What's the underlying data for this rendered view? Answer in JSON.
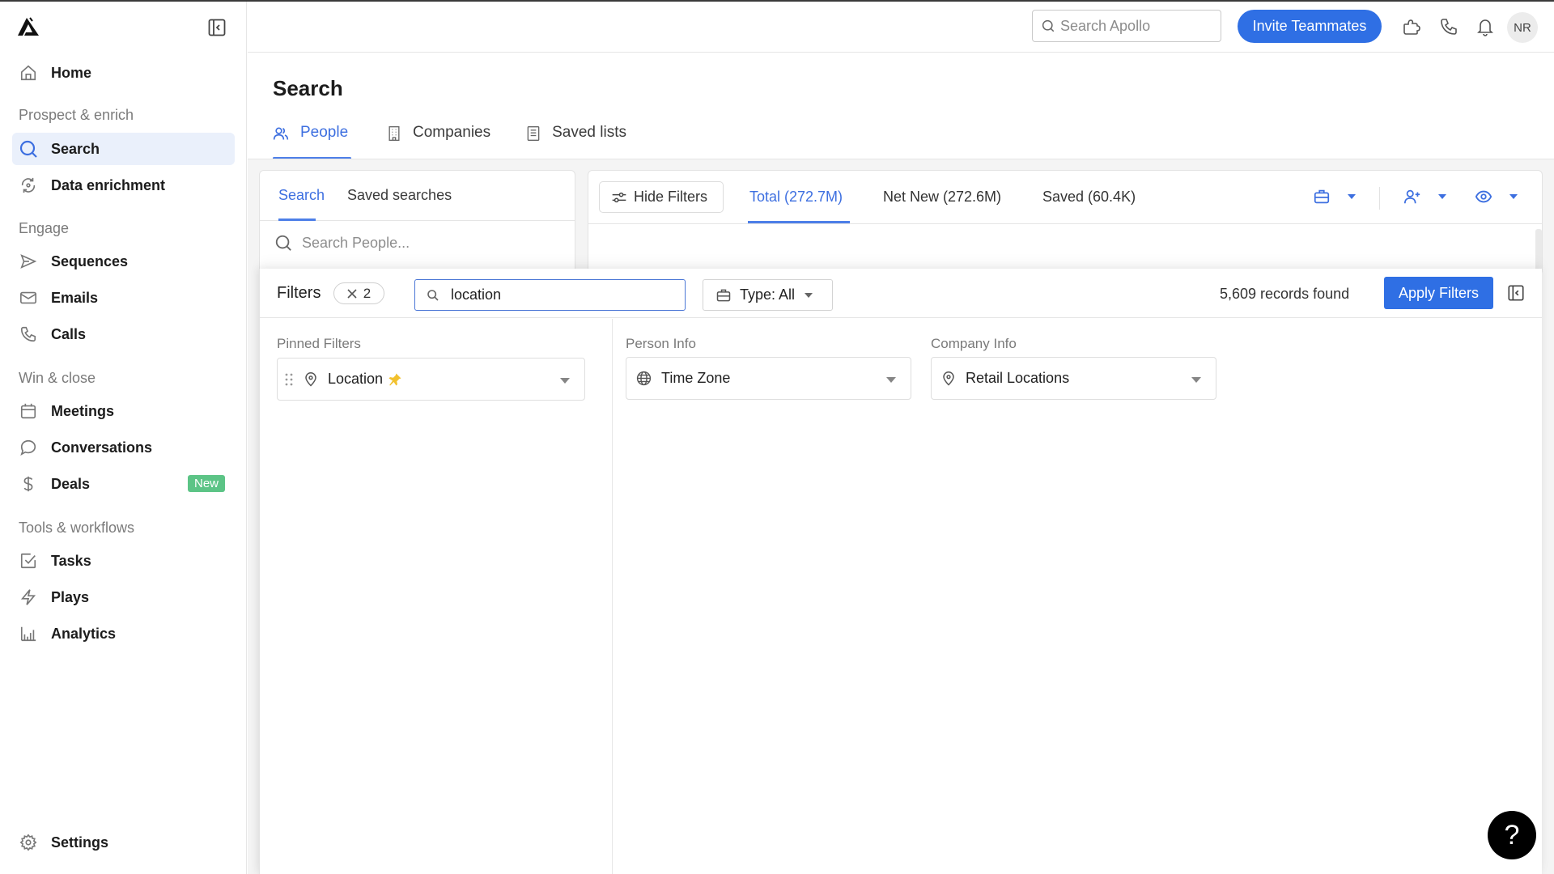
{
  "sidebar": {
    "items": [
      {
        "label": "Home"
      },
      {
        "label": "Search"
      },
      {
        "label": "Data enrichment"
      },
      {
        "label": "Sequences"
      },
      {
        "label": "Emails"
      },
      {
        "label": "Calls"
      },
      {
        "label": "Meetings"
      },
      {
        "label": "Conversations"
      },
      {
        "label": "Deals",
        "badge": "New"
      },
      {
        "label": "Tasks"
      },
      {
        "label": "Plays"
      },
      {
        "label": "Analytics"
      },
      {
        "label": "Settings"
      }
    ],
    "sections": [
      "Prospect & enrich",
      "Engage",
      "Win & close",
      "Tools & workflows"
    ],
    "active_item": "Search"
  },
  "topbar": {
    "search_placeholder": "Search Apollo",
    "invite_label": "Invite Teammates",
    "avatar_initials": "NR"
  },
  "page": {
    "title": "Search",
    "tabs": [
      {
        "label": "People",
        "active": true
      },
      {
        "label": "Companies",
        "active": false
      },
      {
        "label": "Saved lists",
        "active": false
      }
    ]
  },
  "left_card": {
    "tabs": [
      {
        "label": "Search",
        "active": true
      },
      {
        "label": "Saved searches",
        "active": false
      }
    ],
    "search_placeholder": "Search People..."
  },
  "right_card": {
    "hide_filters_label": "Hide Filters",
    "tabs": [
      {
        "label": "Total (272.7M)",
        "active": true
      },
      {
        "label": "Net New (272.6M)",
        "active": false
      },
      {
        "label": "Saved (60.4K)",
        "active": false
      }
    ]
  },
  "filters": {
    "title": "Filters",
    "active_count": "2",
    "search_value": "location",
    "type_label": "Type: All",
    "records_found": "5,609 records found",
    "apply_label": "Apply Filters",
    "groups": [
      {
        "label": "Pinned Filters",
        "items": [
          {
            "label": "Location",
            "pinned": true
          }
        ]
      },
      {
        "label": "Person Info",
        "items": [
          {
            "label": "Time Zone"
          }
        ]
      },
      {
        "label": "Company Info",
        "items": [
          {
            "label": "Retail Locations"
          }
        ]
      }
    ]
  },
  "help": {
    "label": "?"
  },
  "colors": {
    "accent": "#2f6fe4",
    "active_nav_bg": "#eaf0fb",
    "badge_new": "#5cc486",
    "pin": "#f2c12e"
  }
}
